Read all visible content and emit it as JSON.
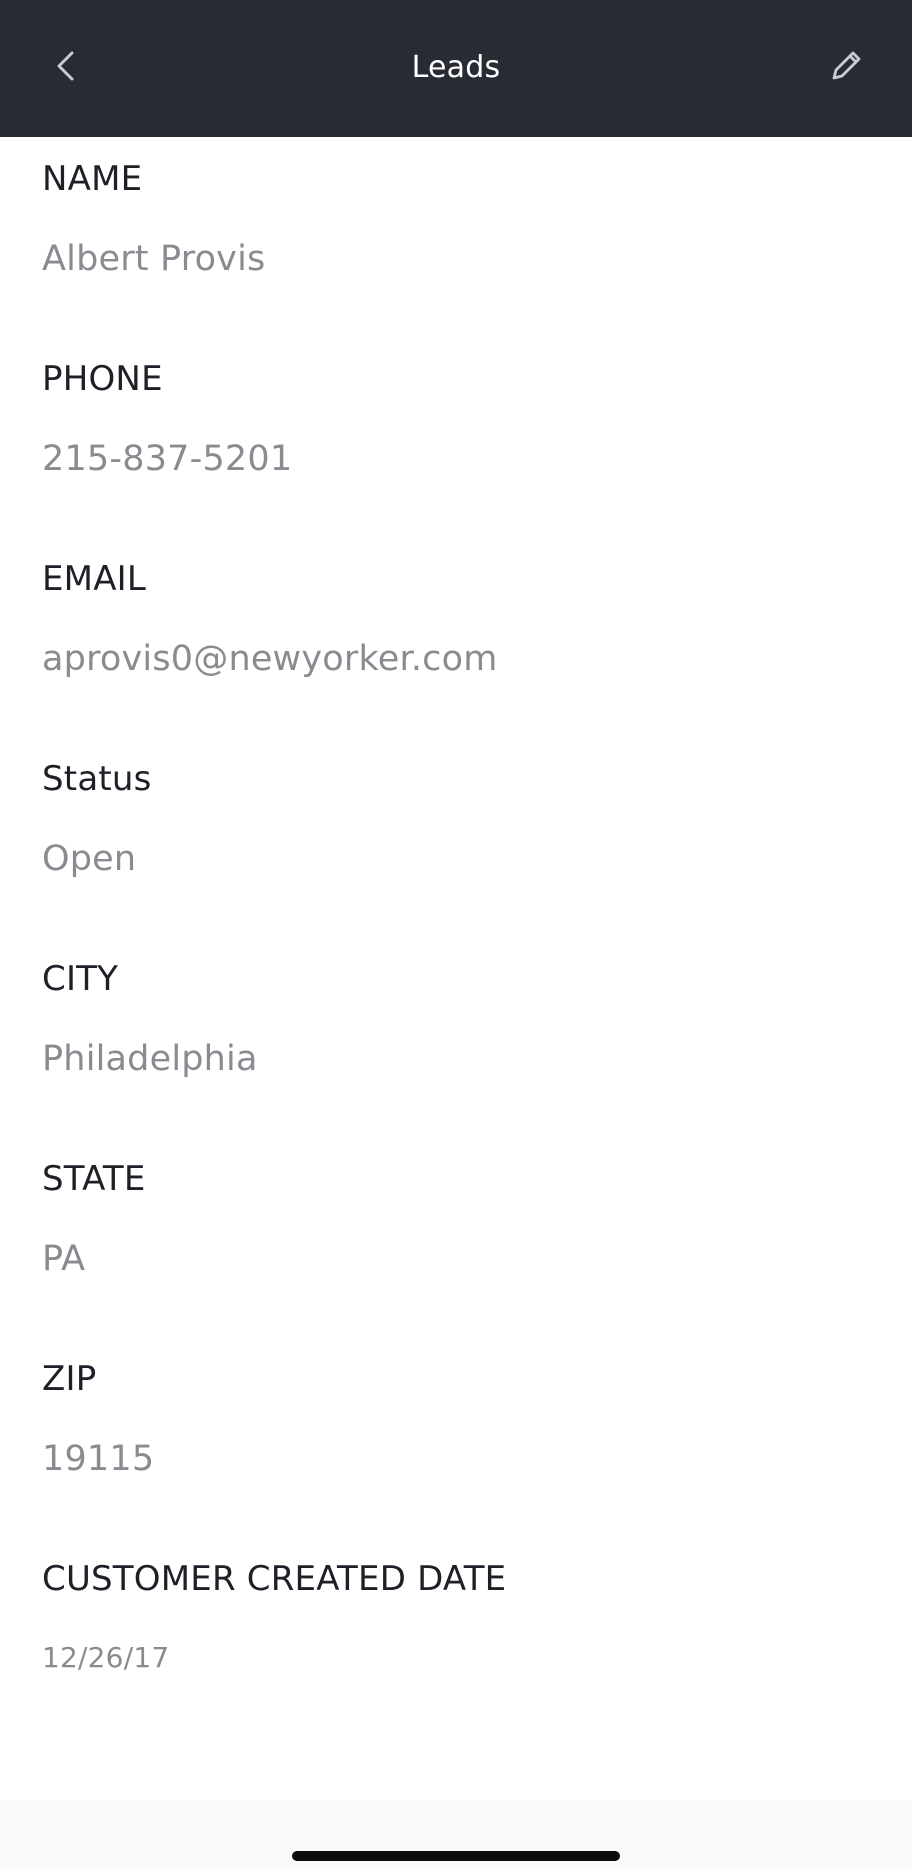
{
  "header": {
    "title": "Leads",
    "back_icon": "chevron-left-icon",
    "edit_icon": "pencil-icon",
    "background_color": "#292b34"
  },
  "fields": [
    {
      "label": "NAME",
      "value": "Albert Provis"
    },
    {
      "label": "PHONE",
      "value": "215-837-5201"
    },
    {
      "label": "EMAIL",
      "value": "aprovis0@newyorker.com"
    },
    {
      "label": "Status",
      "value": "Open"
    },
    {
      "label": "CITY",
      "value": "Philadelphia"
    },
    {
      "label": "STATE",
      "value": "PA"
    },
    {
      "label": "ZIP",
      "value": "19115"
    },
    {
      "label": "CUSTOMER CREATED DATE",
      "value": "12/26/17"
    }
  ],
  "colors": {
    "label": "#1e1f27",
    "value": "#8a8b91"
  }
}
